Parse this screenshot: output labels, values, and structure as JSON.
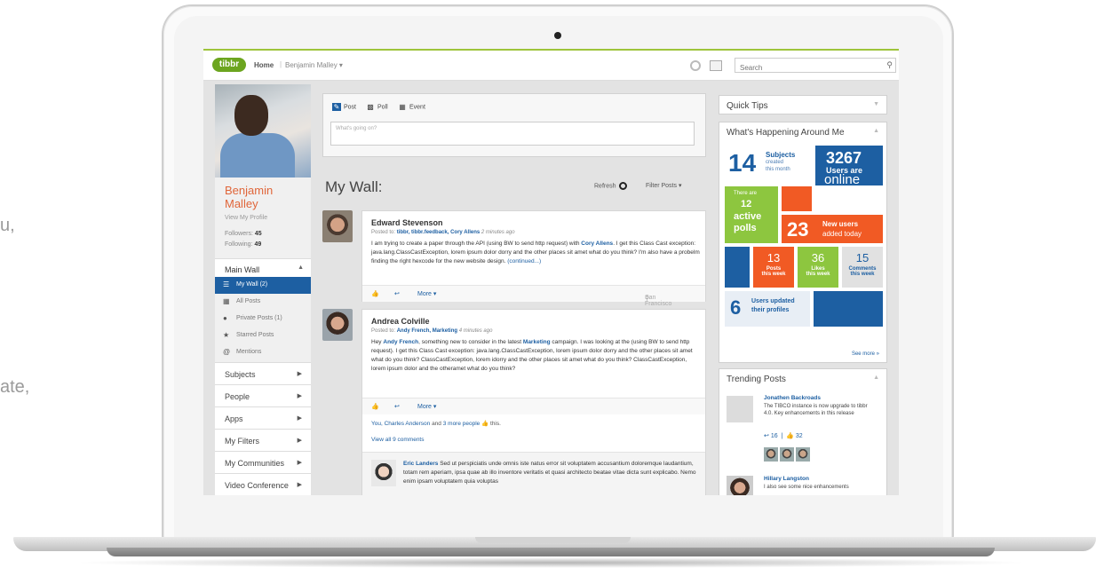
{
  "background_text": {
    "line1": "u,",
    "line2": "ate,"
  },
  "header": {
    "logo": "tibbr",
    "home": "Home",
    "separator": "|",
    "user": "Benjamin Malley ▾",
    "search_placeholder": "Search",
    "search_icon": "magnifier-icon"
  },
  "profile": {
    "name": "Benjamin Malley",
    "view_profile": "View My Profile",
    "followers_label": "Followers:",
    "followers": "45",
    "following_label": "Following:",
    "following": "49"
  },
  "sidebar": {
    "main_wall": "Main Wall",
    "sub_items": [
      {
        "label": "My Wall  (2)",
        "icon": "list-icon"
      },
      {
        "label": "All Posts",
        "icon": "grid-icon"
      },
      {
        "label": "Private Posts  (1)",
        "icon": "lock-icon"
      },
      {
        "label": "Starred Posts",
        "icon": "star-icon"
      },
      {
        "label": "Mentions",
        "icon": "at-icon"
      }
    ],
    "nav_items": [
      "Subjects",
      "People",
      "Apps",
      "My Filters",
      "My Communities",
      "Video Conference"
    ]
  },
  "composer": {
    "tabs": [
      {
        "label": "Post",
        "icon": "pencil-icon"
      },
      {
        "label": "Poll",
        "icon": "bar-chart-icon"
      },
      {
        "label": "Event",
        "icon": "calendar-icon"
      }
    ],
    "placeholder": "What's going on?"
  },
  "wall": {
    "title": "My Wall:",
    "refresh": "Refresh",
    "filter": "Filter Posts ▾"
  },
  "posts": [
    {
      "author": "Edward Stevenson",
      "posted_to_label": "Posted to:",
      "targets": [
        "tibbr,",
        "tibbr.feedback,",
        "Cory Allens"
      ],
      "time": "2 minutes ago",
      "body_a": "I am trying to create a paper through the API (using BW to send http request) with ",
      "body_link": "Cory Allens",
      "body_b": ". I get this Class Cast exception: java.lang.ClassCastException, lorem ipsum dolor dorry and the other places sit amet what do you think? I'm also have a probelm finding the right hexcode for the new website design.",
      "continued": "(continued...)",
      "more": "More ▾",
      "location": "San Francisco"
    },
    {
      "author": "Andrea Colville",
      "posted_to_label": "Posted to:",
      "targets": [
        "Andy French,",
        "Marketing"
      ],
      "time": "4 minutes ago",
      "body_a": "Hey ",
      "body_link1": "Andy French",
      "body_b": ", something new to consider in the latest ",
      "body_link2": "Marketing",
      "body_c": " campaign. I was looking at the (using BW to send http request). I get this Class Cast exception: java.lang.ClassCastException, lorem ipsum dolor dorry and the other places sit amet what do you think? ClassCastException, lorem idorry and the other places sit amet what do you think? ClassCastException, lorem ipsum dolor and the otheramet what do you think?",
      "more": "More ▾",
      "likes_link1": "You, Charles Anderson",
      "likes_and": " and ",
      "likes_link2": "3 more people",
      "likes_tail": " this.",
      "view_all": "View all 9 comments",
      "comment_author": "Eric Landers",
      "comment_text": " Sed ut perspiciatis unde omnis iste natus error sit voluptatem accusantium doloremque laudantium, totam rem aperiam, ipsa quae ab illo inventore veritatis et quasi architecto beatae vitae dicta sunt explicabo. Nemo enim ipsam voluptatem quia voluptas"
    }
  ],
  "quick_tips": {
    "title": "Quick Tips"
  },
  "happening": {
    "title": "What's Happening Around Me",
    "subjects_num": "14",
    "subjects_l1": "Subjects",
    "subjects_l2": "created",
    "subjects_l3": "this month",
    "users_num": "3267",
    "users_l1": "Users are",
    "users_l2": "online",
    "polls_l1": "There are",
    "polls_num": "12",
    "polls_l2": "active",
    "polls_l3": "polls",
    "new_num": "23",
    "new_l1": "New users",
    "new_l2": "added today",
    "posts_num": "13",
    "posts_l1": "Posts",
    "posts_l2": "this week",
    "likes_num": "36",
    "likes_l1": "Likes",
    "likes_l2": "this week",
    "comments_num": "15",
    "comments_l1": "Comments",
    "comments_l2": "this week",
    "updated_num": "6",
    "updated_l1": "Users updated",
    "updated_l2": "their profiles",
    "see_more": "See more »"
  },
  "trending": {
    "title": "Trending Posts",
    "items": [
      {
        "name": "Jonathen Backroads",
        "text": "The TIBCO instance is now upgrade to tibbr 4.0. Key enhancements in this release",
        "shares": "16",
        "likes": "32"
      },
      {
        "name": "Hillary Langston",
        "text": "I also see some nice enhancements"
      }
    ]
  },
  "colors": {
    "accent_blue": "#1d5fa2",
    "orange": "#f15a24",
    "green": "#8dc63f",
    "brand_green": "#6ca51f",
    "name_orange": "#e0663a"
  }
}
